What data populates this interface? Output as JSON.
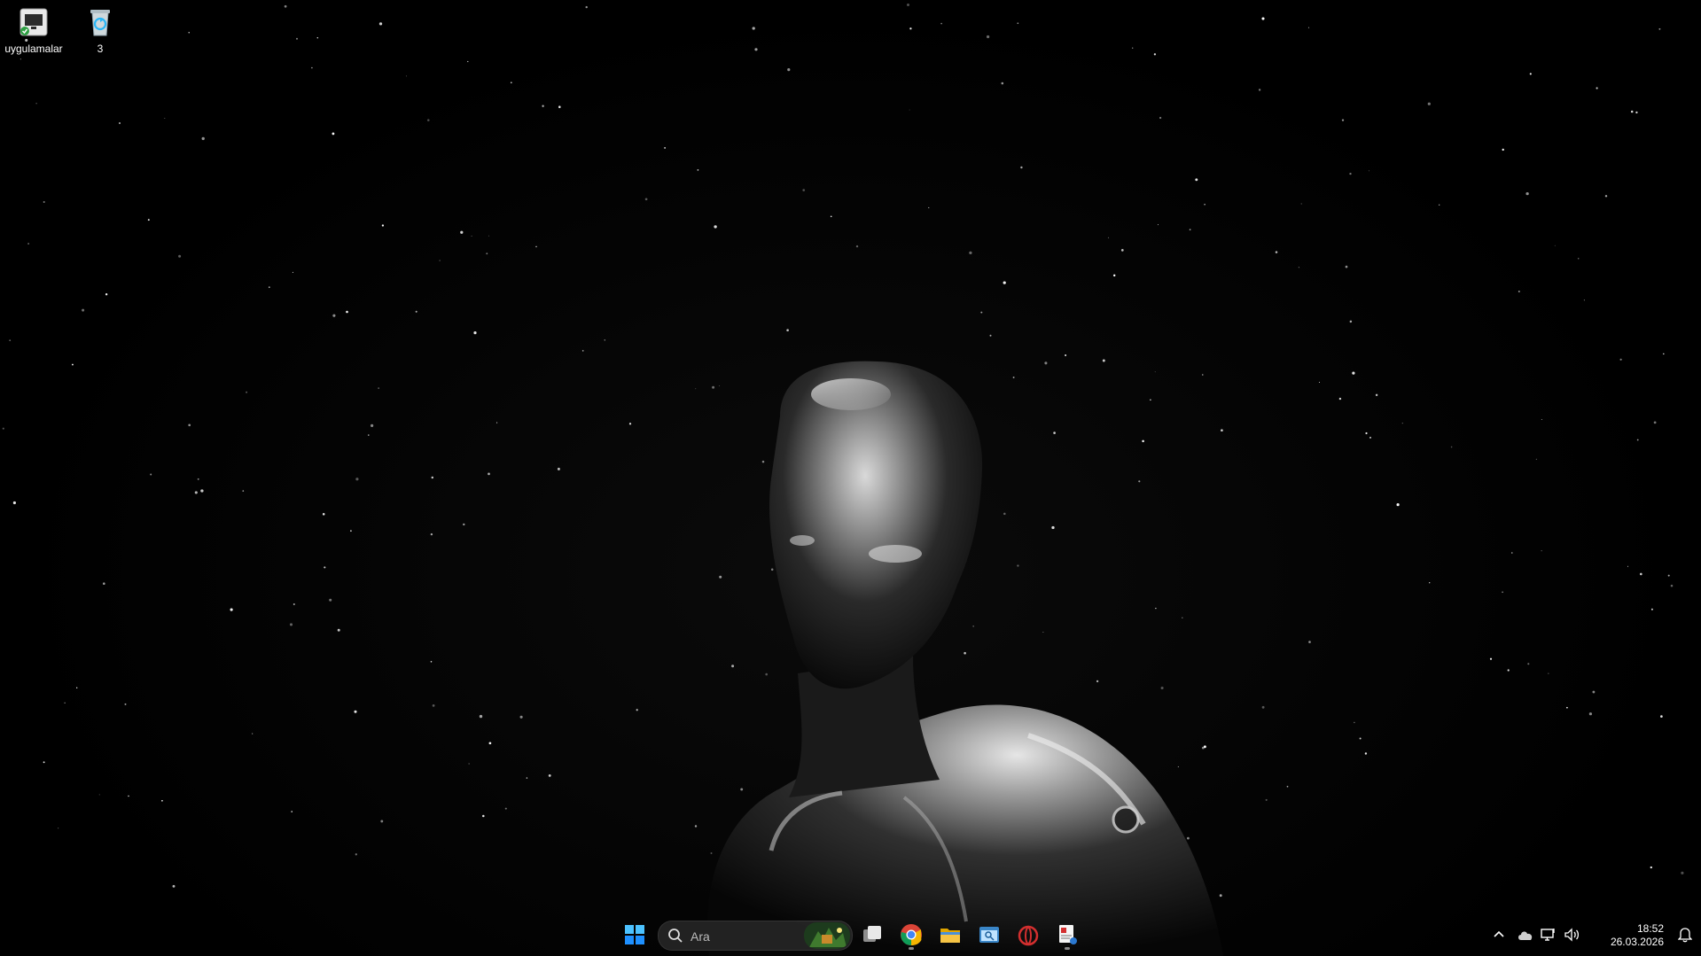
{
  "desktop": {
    "icons": [
      {
        "label": "uygulamalar",
        "icon": "monitor-shortcut-icon"
      },
      {
        "label": "3",
        "icon": "recycle-bin-icon"
      }
    ]
  },
  "taskbar": {
    "search": {
      "placeholder": "Ara"
    },
    "apps": [
      {
        "name": "start",
        "icon": "windows-start-icon"
      },
      {
        "name": "search",
        "icon": "search-icon"
      },
      {
        "name": "task-view",
        "icon": "task-view-icon"
      },
      {
        "name": "chrome",
        "icon": "chrome-icon"
      },
      {
        "name": "file-explorer",
        "icon": "folder-icon"
      },
      {
        "name": "app-window",
        "icon": "app-window-icon"
      },
      {
        "name": "red-app",
        "icon": "red-circle-app-icon"
      },
      {
        "name": "document-app",
        "icon": "document-app-icon"
      }
    ]
  },
  "tray": {
    "icons": [
      "chevron-up-icon",
      "onedrive-cloud-icon",
      "network-icon",
      "volume-icon",
      "notification-icon"
    ],
    "time": "18:52",
    "date": "26.03.2026"
  },
  "colors": {
    "accent": "#1e90ff",
    "chrome_red": "#db4437",
    "chrome_yellow": "#f4b400",
    "chrome_green": "#0f9d58",
    "folder_yellow": "#f6c445"
  }
}
